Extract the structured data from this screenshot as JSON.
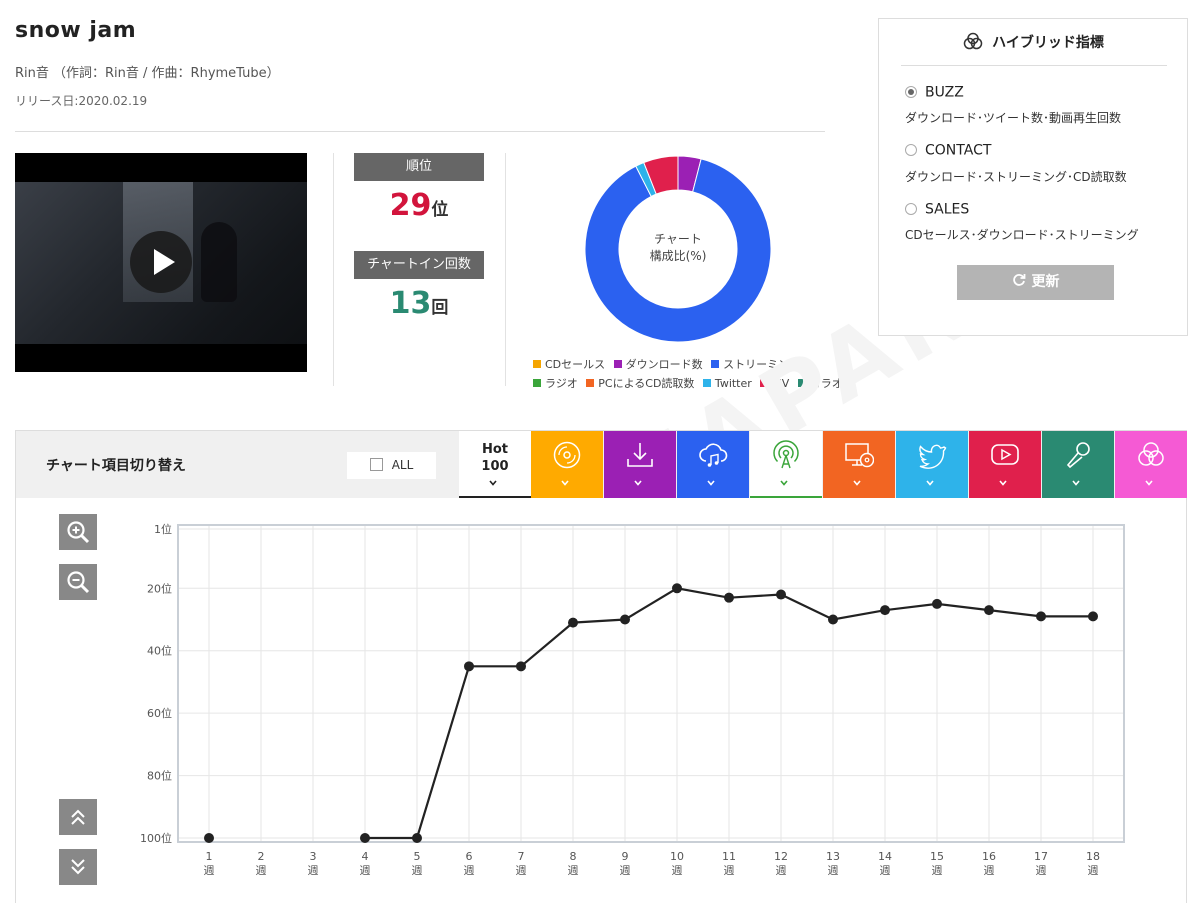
{
  "song": {
    "title": "snow jam",
    "artist_line": "Rin音 （作詞：Rin音 / 作曲：RhymeTube）",
    "release": "リリース日:2020.02.19"
  },
  "stats": {
    "rank_label": "順位",
    "rank_value": "29",
    "rank_unit": "位",
    "chartin_label": "チャートイン回数",
    "chartin_value": "13",
    "chartin_unit": "回",
    "rank_color": "#d2143c",
    "chartin_color": "#2a8a72"
  },
  "composition": {
    "center_line1": "チャート",
    "center_line2": "構成比(%)",
    "legend": [
      {
        "label": "CDセールス",
        "color": "#f5a500"
      },
      {
        "label": "ダウンロード数",
        "color": "#9b20b4"
      },
      {
        "label": "ストリーミング数",
        "color": "#2b61f0"
      },
      {
        "label": "ラジオ",
        "color": "#3aa53a"
      },
      {
        "label": "PCによるCD読取数",
        "color": "#f26522"
      },
      {
        "label": "Twitter",
        "color": "#2eb3ea"
      },
      {
        "label": "MV",
        "color": "#e0204c"
      },
      {
        "label": "カラオケ",
        "color": "#2a8a72"
      }
    ],
    "slices": [
      {
        "label": "ダウンロード数",
        "value": 4,
        "color": "#9b20b4"
      },
      {
        "label": "ストリーミング数",
        "value": 88.5,
        "color": "#2b61f0"
      },
      {
        "label": "Twitter",
        "value": 1.5,
        "color": "#2eb3ea"
      },
      {
        "label": "MV",
        "value": 6,
        "color": "#e0204c"
      }
    ]
  },
  "hybrid": {
    "title": "ハイブリッド指標",
    "options": [
      {
        "label": "BUZZ",
        "desc": "ダウンロード･ツイート数･動画再生回数",
        "checked": true
      },
      {
        "label": "CONTACT",
        "desc": "ダウンロード･ストリーミング･CD読取数",
        "checked": false
      },
      {
        "label": "SALES",
        "desc": "CDセールス･ダウンロード･ストリーミング",
        "checked": false
      }
    ],
    "update_label": "更新"
  },
  "switcher": {
    "label": "チャート項目切り替え",
    "all_label": "ALL",
    "hot_line1": "Hot",
    "hot_line2": "100",
    "tabs": [
      {
        "icon": "cd-icon",
        "color": "#ffaa00"
      },
      {
        "icon": "download-icon",
        "color": "#9b20b4"
      },
      {
        "icon": "cloud-music-icon",
        "color": "#2b61f0"
      },
      {
        "icon": "radio-icon",
        "color": "#ffffff"
      },
      {
        "icon": "pc-cd-icon",
        "color": "#f26522"
      },
      {
        "icon": "twitter-icon",
        "color": "#2eb3ea"
      },
      {
        "icon": "video-icon",
        "color": "#e0204c"
      },
      {
        "icon": "microphone-icon",
        "color": "#2a8a72"
      },
      {
        "icon": "hybrid-icon",
        "color": "#f55ad4"
      }
    ]
  },
  "watermark": "JAPAN",
  "chart_data": {
    "type": "line",
    "y_reversed": true,
    "ylim": [
      1,
      100
    ],
    "y_ticks": [
      1,
      20,
      40,
      60,
      80,
      100
    ],
    "y_tick_labels": [
      "1位",
      "20位",
      "40位",
      "60位",
      "80位",
      "100位"
    ],
    "x": [
      1,
      2,
      3,
      4,
      5,
      6,
      7,
      8,
      9,
      10,
      11,
      12,
      13,
      14,
      15,
      16,
      17,
      18
    ],
    "x_labels_num": [
      "1",
      "2",
      "3",
      "4",
      "5",
      "6",
      "7",
      "8",
      "9",
      "10",
      "11",
      "12",
      "13",
      "14",
      "15",
      "16",
      "17",
      "18"
    ],
    "x_unit": "週",
    "series": [
      {
        "values": [
          100,
          null,
          null,
          100,
          100,
          45,
          45,
          31,
          30,
          20,
          23,
          22,
          30,
          27,
          25,
          27,
          29,
          29
        ],
        "color": "#222222"
      }
    ],
    "grid": true
  }
}
